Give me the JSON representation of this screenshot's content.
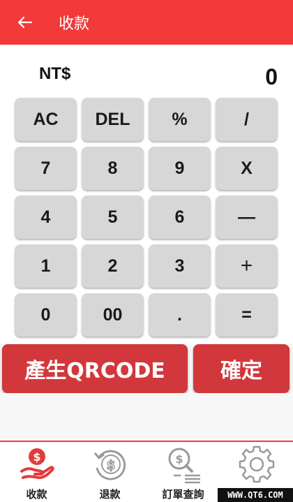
{
  "header": {
    "title": "收款",
    "bg_color": "#f23a3a",
    "back_icon": "arrow-left-icon"
  },
  "display": {
    "currency": "NT$",
    "amount": "0"
  },
  "keypad": {
    "rows": [
      [
        "AC",
        "DEL",
        "%",
        "/"
      ],
      [
        "7",
        "8",
        "9",
        "X"
      ],
      [
        "4",
        "5",
        "6",
        "—"
      ],
      [
        "1",
        "2",
        "3",
        "+"
      ],
      [
        "0",
        "00",
        ".",
        "="
      ]
    ]
  },
  "actions": {
    "qrcode_label": "產生QRCODE",
    "confirm_label": "確定",
    "color": "#d2373c"
  },
  "tabs": [
    {
      "label": "收款",
      "icon": "money-hand-icon",
      "active": true
    },
    {
      "label": "退款",
      "icon": "refund-dollar-icon",
      "active": false
    },
    {
      "label": "訂單查詢",
      "icon": "order-search-icon",
      "active": false
    },
    {
      "label": "",
      "icon": "gear-icon",
      "active": false
    }
  ],
  "watermark": "WWW.QT6.COM"
}
